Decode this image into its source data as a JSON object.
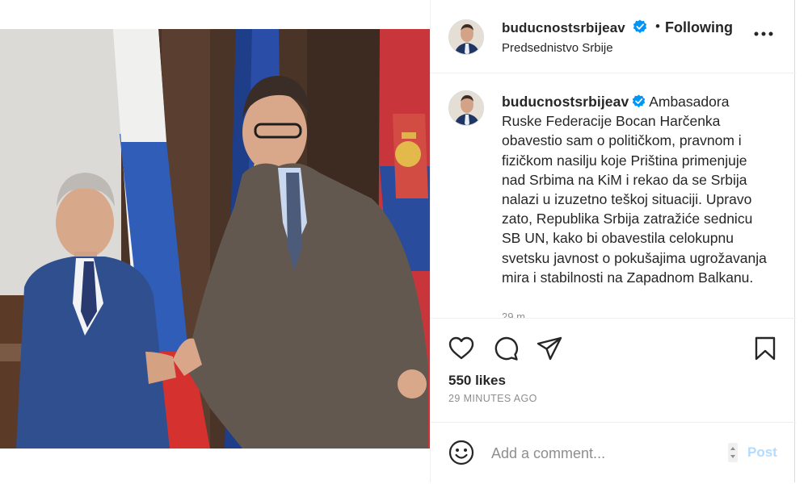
{
  "post": {
    "author": {
      "username": "buducnostsrbijeav",
      "verified": true,
      "follow_status": "Following",
      "location": "Predsednistvo Srbije",
      "avatar_icon": "avatar-photo"
    },
    "header_separator": "•",
    "caption": {
      "username": "buducnostsrbijeav",
      "text": "Ambasadora Ruske Federacije Bocan Harčenka obavestio sam o političkom, pravnom i fizičkom nasilju koje Priština primenjuje nad Srbima na KiM i rekao da se Srbija nalazi u izuzetno teškoj situaciji. Upravo zato, Republika Srbija zatražiće sednicu SB UN, kako bi obavestila celokupnu svetsku javnost o pokušajima ugrožavanja mira i stabilnosti na Zapadnom Balkanu.",
      "relative_time": "29 m"
    },
    "actions": {
      "icons": [
        "heart-icon",
        "comment-icon",
        "share-icon",
        "bookmark-icon"
      ]
    },
    "likes_label": "550 likes",
    "timestamp": "29 MINUTES AGO",
    "comment_box": {
      "placeholder": "Add a comment...",
      "post_label": "Post"
    },
    "colors": {
      "verified_blue": "#0095f6",
      "post_button_disabled": "#b3dbff",
      "muted_text": "#8e8e8e"
    }
  }
}
